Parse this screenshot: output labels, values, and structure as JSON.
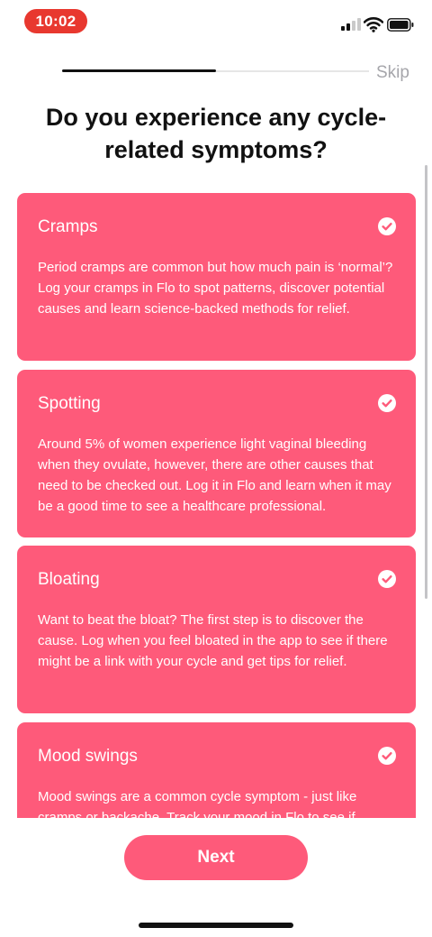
{
  "status_bar": {
    "time": "10:02",
    "signal_icon": "cellular-signal-icon",
    "wifi_icon": "wifi-icon",
    "battery_icon": "battery-icon",
    "time_pill_color": "#e8382f"
  },
  "header": {
    "progress_fraction": 0.5,
    "skip_label": "Skip"
  },
  "title": "Do you experience any cycle-related symptoms?",
  "accent_color": "#fe5a7a",
  "symptoms": [
    {
      "title": "Cramps",
      "description": "Period cramps are common but how much pain is ‘normal’? Log your cramps in Flo to spot patterns, discover potential causes and learn science-backed methods for relief.",
      "selected": true
    },
    {
      "title": "Spotting",
      "description": "Around 5% of women experience light vaginal bleeding when they ovulate, however, there are other causes that need to be checked out. Log it in Flo and learn when it may be a good time to see a healthcare professional.",
      "selected": true
    },
    {
      "title": "Bloating",
      "description": "Want to beat the bloat? The first step is to discover the cause. Log when you feel bloated in the app to see if there might be a link with your cycle and get tips for relief.",
      "selected": true
    },
    {
      "title": "Mood swings",
      "description": "Mood swings are a common cycle symptom - just like cramps or backache. Track your mood in Flo to see if",
      "selected": true
    }
  ],
  "next_label": "Next",
  "check_icon": "checkmark-circle-icon"
}
